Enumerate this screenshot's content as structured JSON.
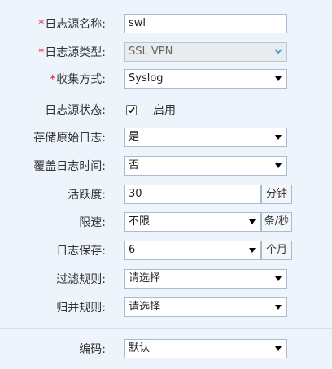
{
  "form": {
    "source_name": {
      "label": "日志源名称:",
      "value": "swl",
      "required": true
    },
    "source_type": {
      "label": "日志源类型:",
      "value": "SSL VPN",
      "required": true
    },
    "collect_method": {
      "label": "收集方式:",
      "value": "Syslog",
      "required": true
    },
    "source_status": {
      "label": "日志源状态:",
      "checked": true,
      "checkbox_label": "启用"
    },
    "store_raw": {
      "label": "存储原始日志:",
      "value": "是"
    },
    "override_time": {
      "label": "覆盖日志时间:",
      "value": "否"
    },
    "activity": {
      "label": "活跃度:",
      "value": "30",
      "unit": "分钟"
    },
    "rate_limit": {
      "label": "限速:",
      "value": "不限",
      "unit": "条/秒"
    },
    "log_retention": {
      "label": "日志保存:",
      "value": "6",
      "unit": "个月"
    },
    "filter_rule": {
      "label": "过滤规则:",
      "value": "请选择"
    },
    "merge_rule": {
      "label": "归并规则:",
      "value": "请选择"
    },
    "encoding": {
      "label": "编码:",
      "value": "默认"
    }
  },
  "colors": {
    "required_mark": "#e01919",
    "border": "#a9bccf",
    "background": "#eef4fb"
  }
}
